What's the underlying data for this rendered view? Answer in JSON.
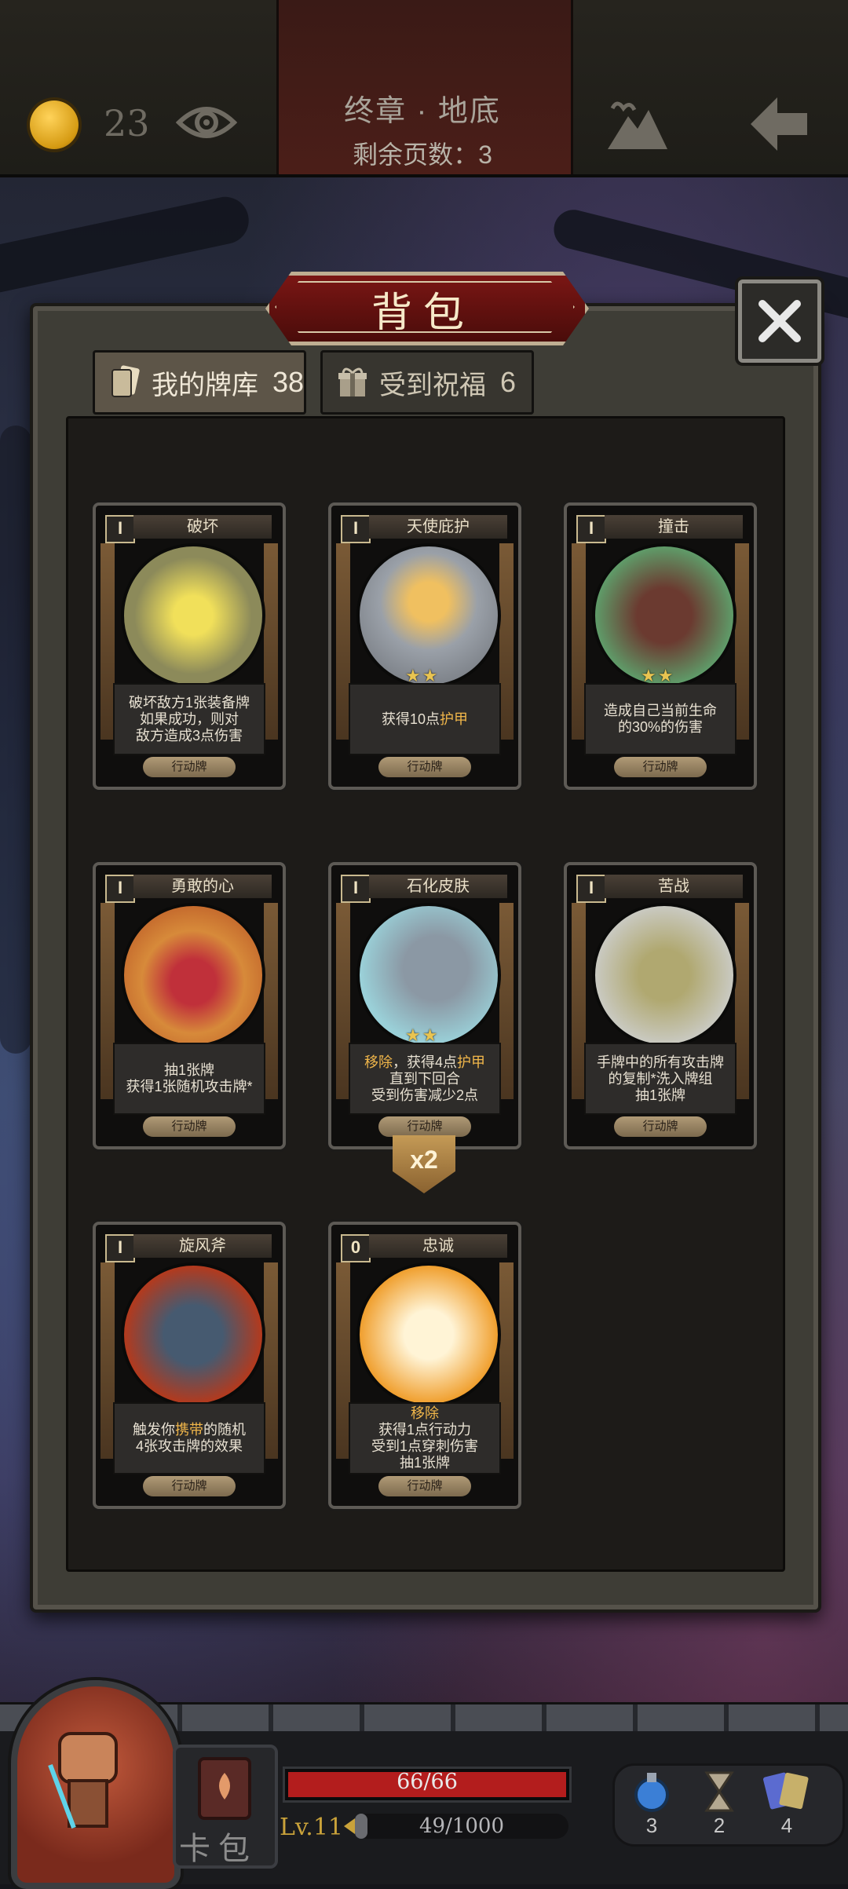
{
  "header": {
    "coins": "23",
    "chapter_title": "终章 · 地底",
    "pages_left": "剩余页数：3"
  },
  "modal": {
    "title": "背包",
    "tabs": [
      {
        "label": "我的牌库",
        "count": "38"
      },
      {
        "label": "受到祝福",
        "count": "6"
      }
    ]
  },
  "cards": [
    {
      "name": "破坏",
      "cost": "I",
      "lines": [
        "破坏敌方1张装备牌",
        "如果成功，则对",
        "敌方造成3点伤害"
      ],
      "type": "行动牌",
      "stars": ""
    },
    {
      "name": "天使庇护",
      "cost": "I",
      "lines": [
        "获得10点护甲"
      ],
      "type": "行动牌",
      "stars": "★★"
    },
    {
      "name": "撞击",
      "cost": "I",
      "lines": [
        "造成自己当前生命",
        "的30%的伤害"
      ],
      "type": "行动牌",
      "stars": "★★"
    },
    {
      "name": "勇敢的心",
      "cost": "I",
      "lines": [
        "抽1张牌",
        "获得1张随机攻击牌*"
      ],
      "type": "行动牌",
      "stars": ""
    },
    {
      "name": "石化皮肤",
      "cost": "I",
      "lines": [
        "移除，获得4点护甲",
        "直到下回合",
        "受到伤害减少2点"
      ],
      "type": "行动牌",
      "stars": "★★"
    },
    {
      "name": "苦战",
      "cost": "I",
      "lines": [
        "手牌中的所有攻击牌",
        "的复制*洗入牌组",
        "抽1张牌"
      ],
      "type": "行动牌",
      "stars": ""
    },
    {
      "name": "旋风斧",
      "cost": "I",
      "lines": [
        "触发你携带的随机",
        "4张攻击牌的效果"
      ],
      "type": "行动牌",
      "stars": ""
    },
    {
      "name": "忠诚",
      "cost": "0",
      "lines": [
        "移除",
        "获得1点行动力",
        "受到1点穿刺伤害",
        "抽1张牌"
      ],
      "type": "行动牌",
      "stars": ""
    }
  ],
  "duplicate_badge": "x2",
  "hud": {
    "card_pack_label": "卡包",
    "hp_text": "66/66",
    "hp_fraction": 1.0,
    "level": "Lv.11",
    "xp_text": "49/1000",
    "xp_fraction": 0.049,
    "resources": [
      "3",
      "2",
      "4"
    ]
  },
  "colors": {
    "highlight": "#f0b64a",
    "hp": "#b31d1d",
    "ribbon": "#7a1614"
  }
}
